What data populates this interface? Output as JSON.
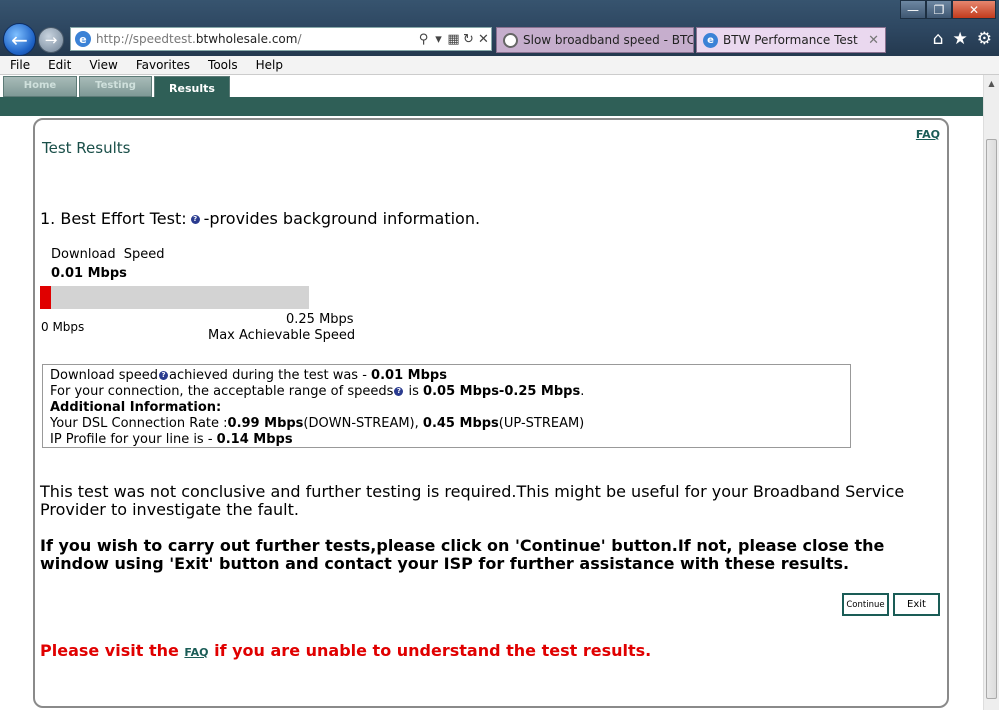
{
  "browser": {
    "address_url_prefix": "http://speedtest.",
    "address_url_domain": "btwholesale.com",
    "address_url_suffix": "/",
    "tabs": [
      {
        "title": "Slow broadband speed - BTCar..."
      },
      {
        "title": "BTW Performance Test"
      }
    ],
    "menu": [
      "File",
      "Edit",
      "View",
      "Favorites",
      "Tools",
      "Help"
    ]
  },
  "site": {
    "tabs": [
      "Home",
      "Testing",
      "Results"
    ],
    "active_tab": "Results",
    "faq_link": "FAQ",
    "title": "Test Results",
    "best_effort": {
      "heading": "1. Best Effort Test:",
      "description": "-provides background information."
    },
    "download": {
      "label": "Download  Speed",
      "value_text": "0.01 Mbps",
      "value": 0.01,
      "max": 0.25,
      "min_label": "0 Mbps",
      "max_value_text": "0.25 Mbps",
      "max_label": "Max Achievable Speed"
    },
    "info_box": {
      "line1_prefix": "Download speed",
      "line1_mid": "achieved during the test was - ",
      "line1_value": "0.01 Mbps",
      "line2_prefix": "For your connection, the acceptable range of speeds",
      "line2_mid": " is ",
      "line2_value": "0.05 Mbps-0.25 Mbps",
      "line2_end": ".",
      "additional_heading": "Additional Information:",
      "dsl_prefix": "Your DSL Connection Rate :",
      "dsl_down_value": "0.99 Mbps",
      "dsl_down_label": "(DOWN-STREAM), ",
      "dsl_up_value": "0.45 Mbps",
      "dsl_up_label": "(UP-STREAM)",
      "ip_prefix": "IP Profile for your line is - ",
      "ip_value": "0.14 Mbps"
    },
    "not_conclusive": "This test was not conclusive and further testing is required.This might be useful for your Broadband Service Provider to investigate the fault.",
    "further_tests": "If you wish to carry out further tests,please click on 'Continue' button.If not, please close the window using 'Exit' button and contact your ISP for further assistance with these results.",
    "buttons": {
      "continue": "Continue",
      "exit": "Exit"
    },
    "visit_faq": {
      "prefix": "Please visit the ",
      "link": "FAQ",
      "suffix": " if you are unable to understand the test results."
    }
  },
  "colors": {
    "accent_teal": "#2f5f57",
    "alert_red": "#e00000"
  }
}
